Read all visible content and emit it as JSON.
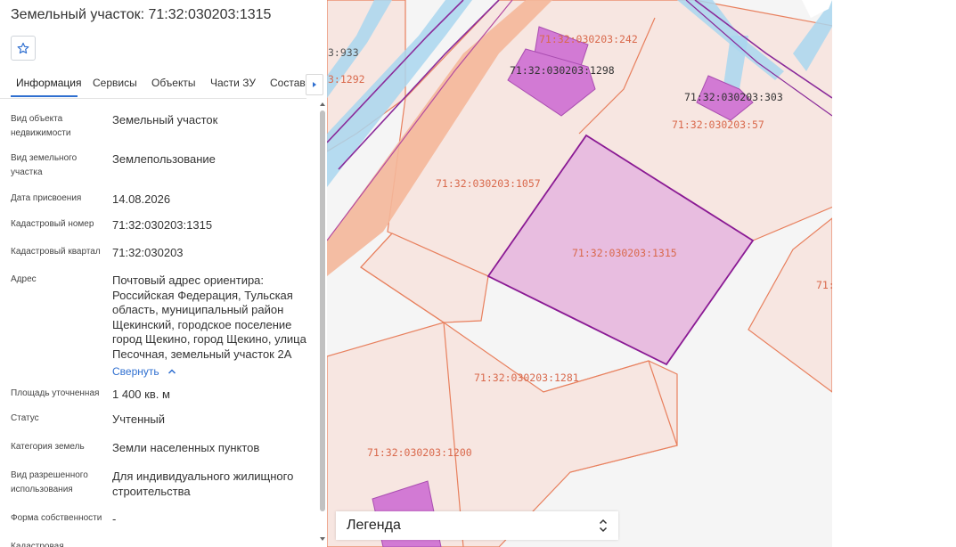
{
  "panel": {
    "title": "Земельный участок: 71:32:030203:1315",
    "tabs": [
      "Информация",
      "Сервисы",
      "Объекты",
      "Части ЗУ",
      "Состав"
    ],
    "rows": [
      {
        "label": "Вид объекта недвижимости",
        "value": "Земельный участок"
      },
      {
        "label": "Вид земельного участка",
        "value": "Землепользование"
      },
      {
        "label": "Дата присвоения",
        "value": "14.08.2026"
      },
      {
        "label": "Кадастровый номер",
        "value": "71:32:030203:1315"
      },
      {
        "label": "Кадастровый квартал",
        "value": "71:32:030203"
      },
      {
        "label": "Адрес",
        "value": "Почтовый адрес ориентира: Российская Федерация, Тульская область, муниципальный район Щекинский, городское поселение город Щекино, город Щекино, улица Песочная, земельный участок 2А"
      },
      {
        "label": "Площадь уточненная",
        "value": "1 400 кв. м"
      },
      {
        "label": "Статус",
        "value": "Учтенный"
      },
      {
        "label": "Категория земель",
        "value": "Земли населенных пунктов"
      },
      {
        "label": "Вид разрешенного использования",
        "value": "Для индивидуального жилищного строительства"
      },
      {
        "label": "Форма собственности",
        "value": "-"
      },
      {
        "label": "Кадастровая",
        "value": "-"
      }
    ],
    "collapse_label": "Свернуть"
  },
  "map": {
    "labels": {
      "p933": "3:933",
      "p1292": "3:1292",
      "p242": "71:32:030203:242",
      "p1298": "71:32:030203:1298",
      "p303": "71:32:030203:303",
      "p57": "71:32:030203:57",
      "p1057": "71:32:030203:1057",
      "p1315": "71:32:030203:1315",
      "p71": "71:",
      "p1281": "71:32:030203:1281",
      "p1200": "71:32:030203:1200"
    },
    "colors": {
      "selected_fill": "#e8bde0",
      "selected_stroke": "#8a1a94",
      "parcel_fill": "#f7e6e1",
      "parcel_stroke": "#e8805e",
      "building_fill": "#d27ad4",
      "road_fill": "#f4b79a",
      "water": "#a9d6ef",
      "boundary": "#8a2a9a"
    }
  },
  "legend": {
    "label": "Легенда"
  }
}
